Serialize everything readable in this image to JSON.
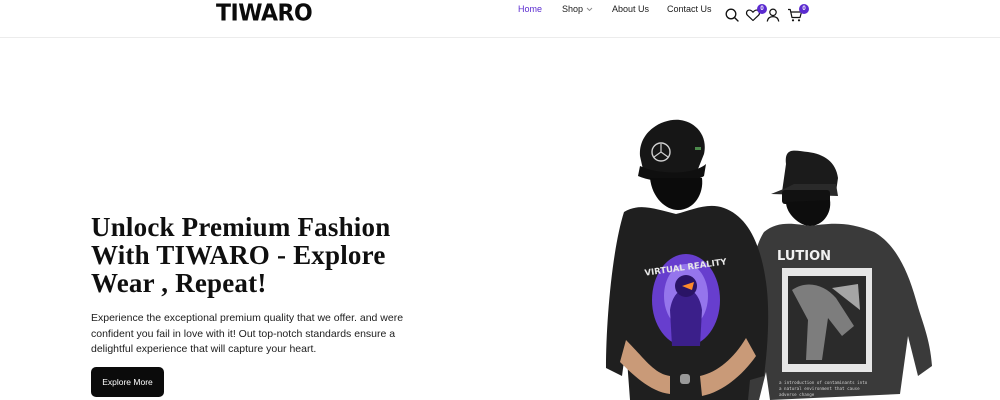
{
  "brand": {
    "logo_text": "TIWARO"
  },
  "nav": {
    "items": [
      {
        "label": "Home",
        "active": true
      },
      {
        "label": "Shop",
        "has_dropdown": true
      },
      {
        "label": "About Us"
      },
      {
        "label": "Contact Us"
      }
    ]
  },
  "header_icons": {
    "search": {
      "icon": "search-icon"
    },
    "wishlist": {
      "icon": "heart-icon",
      "count": "0"
    },
    "account": {
      "icon": "user-icon"
    },
    "cart": {
      "icon": "cart-icon",
      "count": "0"
    }
  },
  "hero": {
    "title": "Unlock Premium Fashion With TIWARO - Explore Wear , Repeat!",
    "description": "Experience the exceptional premium quality that we offer. and were confident you fail in love with it! Out top-notch standards ensure a delightful experience that will capture your heart.",
    "cta_label": "Explore More",
    "front_shirt_text": "VIRTUAL REALITY",
    "back_shirt_text": "LUTION"
  },
  "colors": {
    "accent": "#5b2bd0",
    "button_bg": "#0b0b0b",
    "text": "#111111"
  }
}
